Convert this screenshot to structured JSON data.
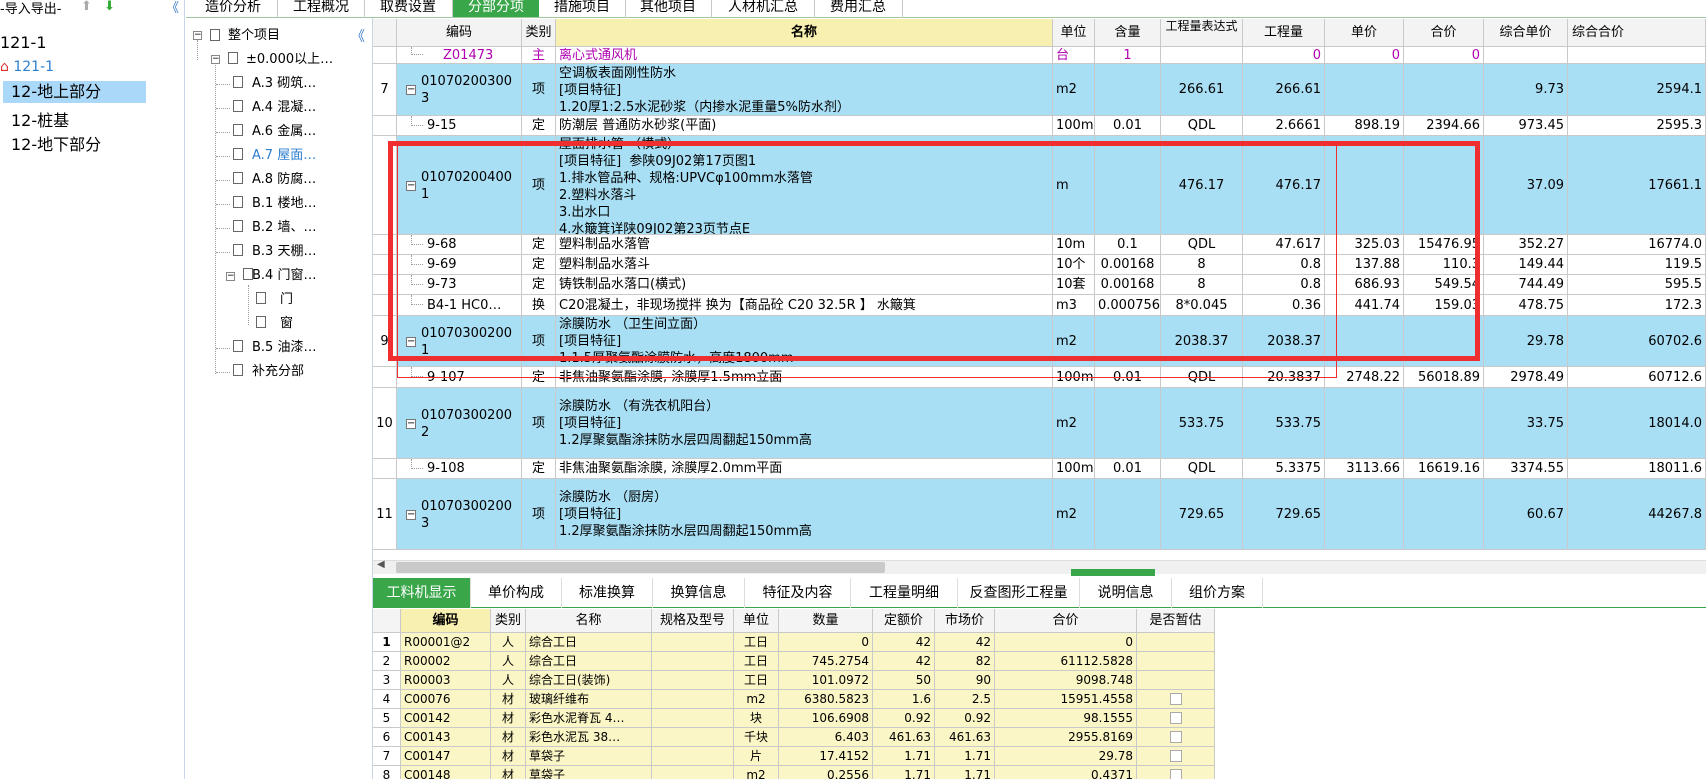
{
  "left_panel": {
    "header": "-导入导出-",
    "project": "121-1",
    "sub_project": "121-1",
    "items": [
      "12-地上部分",
      "12-桩基",
      "12-地下部分"
    ]
  },
  "tree": {
    "root": "整个项目",
    "items": [
      "±0.000以上…",
      "A.3 砌筑…",
      "A.4 混凝…",
      "A.6 金属…",
      "A.7 屋面…",
      "A.8 防腐…",
      "B.1 楼地…",
      "B.2 墙、…",
      "B.3 天棚…",
      "B.4 门窗…",
      "门",
      "窗",
      "B.5 油漆…",
      "补充分部"
    ]
  },
  "top_tabs": [
    "造价分析",
    "工程概况",
    "取费设置",
    "分部分项",
    "措施项目",
    "其他项目",
    "人材机汇总",
    "费用汇总"
  ],
  "grid": {
    "headers": [
      "编码",
      "类别",
      "名称",
      "单位",
      "含量",
      "工程量表达式",
      "工程量",
      "单价",
      "合价",
      "综合单价",
      "综合合价"
    ],
    "rows": [
      {
        "no": "",
        "code": "Z01473",
        "type": "主",
        "name": "离心式通风机",
        "unit": "台",
        "qty_rate": "1",
        "expr": "",
        "qty": "0",
        "price": "0",
        "total": "0",
        "unit_price": "",
        "sum": ""
      },
      {
        "no": "7",
        "code": "01070200300\n3",
        "type": "项",
        "name": "空调板表面刚性防水\n[项目特征]\n1.20厚1:2.5水泥砂浆（内掺水泥重量5%防水剂）",
        "unit": "m2",
        "qty_rate": "",
        "expr": "266.61",
        "qty": "266.61",
        "price": "",
        "total": "",
        "unit_price": "9.73",
        "sum": "2594.1"
      },
      {
        "no": "",
        "code": "9-15",
        "type": "定",
        "name": "防潮层 普通防水砂浆(平面)",
        "unit": "100m2",
        "qty_rate": "0.01",
        "expr": "QDL",
        "qty": "2.6661",
        "price": "898.19",
        "total": "2394.66",
        "unit_price": "973.45",
        "sum": "2595.3"
      },
      {
        "no": "",
        "code": "01070200400\n1",
        "type": "项",
        "name": "屋面排水管 （横式）\n[项目特征]  参陕09J02第17页图1\n1.排水管品种、规格:UPVCφ100mm水落管\n2.塑料水落斗\n3.出水口\n4.水簸箕详陕09J02第23页节点E",
        "unit": "m",
        "qty_rate": "",
        "expr": "476.17",
        "qty": "476.17",
        "price": "",
        "total": "",
        "unit_price": "37.09",
        "sum": "17661.1"
      },
      {
        "no": "",
        "code": "9-68",
        "type": "定",
        "name": "塑料制品水落管",
        "unit": "10m",
        "qty_rate": "0.1",
        "expr": "QDL",
        "qty": "47.617",
        "price": "325.03",
        "total": "15476.95",
        "unit_price": "352.27",
        "sum": "16774.0"
      },
      {
        "no": "",
        "code": "9-69",
        "type": "定",
        "name": "塑料制品水落斗",
        "unit": "10个",
        "qty_rate": "0.00168",
        "expr": "8",
        "qty": "0.8",
        "price": "137.88",
        "total": "110.3",
        "unit_price": "149.44",
        "sum": "119.5"
      },
      {
        "no": "",
        "code": "9-73",
        "type": "定",
        "name": "铸铁制品水落口(横式)",
        "unit": "10套",
        "qty_rate": "0.00168",
        "expr": "8",
        "qty": "0.8",
        "price": "686.93",
        "total": "549.54",
        "unit_price": "744.49",
        "sum": "595.5"
      },
      {
        "no": "",
        "code": "B4-1 HC0…",
        "type": "换",
        "name": "C20混凝土，非现场搅拌  换为【商品砼 C20 32.5R 】 水簸箕",
        "unit": "m3",
        "qty_rate": "0.000756",
        "expr": "8*0.045",
        "qty": "0.36",
        "price": "441.74",
        "total": "159.03",
        "unit_price": "478.75",
        "sum": "172.3"
      },
      {
        "no": "9",
        "code": "01070300200\n1",
        "type": "项",
        "name": "涂膜防水 （卫生间立面）\n[项目特征]\n1.1.5厚聚氨酯涂膜防水，高度1800mm",
        "unit": "m2",
        "qty_rate": "",
        "expr": "2038.37",
        "qty": "2038.37",
        "price": "",
        "total": "",
        "unit_price": "29.78",
        "sum": "60702.6"
      },
      {
        "no": "",
        "code": "9-107",
        "type": "定",
        "name": "非焦油聚氨酯涂膜, 涂膜厚1.5mm立面",
        "unit": "100m2",
        "qty_rate": "0.01",
        "expr": "QDL",
        "qty": "20.3837",
        "price": "2748.22",
        "total": "56018.89",
        "unit_price": "2978.49",
        "sum": "60712.6"
      },
      {
        "no": "10",
        "code": "01070300200\n2",
        "type": "项",
        "name": "涂膜防水 （有洗衣机阳台）\n[项目特征]\n1.2厚聚氨酯涂抹防水层四周翻起150mm高",
        "unit": "m2",
        "qty_rate": "",
        "expr": "533.75",
        "qty": "533.75",
        "price": "",
        "total": "",
        "unit_price": "33.75",
        "sum": "18014.0"
      },
      {
        "no": "",
        "code": "9-108",
        "type": "定",
        "name": "非焦油聚氨酯涂膜, 涂膜厚2.0mm平面",
        "unit": "100m2",
        "qty_rate": "0.01",
        "expr": "QDL",
        "qty": "5.3375",
        "price": "3113.66",
        "total": "16619.16",
        "unit_price": "3374.55",
        "sum": "18011.6"
      },
      {
        "no": "11",
        "code": "01070300200\n3",
        "type": "项",
        "name": "涂膜防水 （厨房）\n[项目特征]\n1.2厚聚氨酯涂抹防水层四周翻起150mm高",
        "unit": "m2",
        "qty_rate": "",
        "expr": "729.65",
        "qty": "729.65",
        "price": "",
        "total": "",
        "unit_price": "60.67",
        "sum": "44267.8"
      }
    ]
  },
  "bottom_tabs": [
    "工料机显示",
    "单价构成",
    "标准换算",
    "换算信息",
    "特征及内容",
    "工程量明细",
    "反查图形工程量",
    "说明信息",
    "组价方案"
  ],
  "bottom_grid": {
    "headers": [
      "编码",
      "类别",
      "名称",
      "规格及型号",
      "单位",
      "数量",
      "定额价",
      "市场价",
      "合价",
      "是否暂估"
    ],
    "rows": [
      {
        "no": "1",
        "code": "R00001@2",
        "type": "人",
        "name": "综合工日",
        "spec": "",
        "unit": "工日",
        "qty": "0",
        "quota": "42",
        "market": "42",
        "total": "0",
        "est": false
      },
      {
        "no": "2",
        "code": "R00002",
        "type": "人",
        "name": "综合工日",
        "spec": "",
        "unit": "工日",
        "qty": "745.2754",
        "quota": "42",
        "market": "82",
        "total": "61112.5828",
        "est": false
      },
      {
        "no": "3",
        "code": "R00003",
        "type": "人",
        "name": "综合工日(装饰)",
        "spec": "",
        "unit": "工日",
        "qty": "101.0972",
        "quota": "50",
        "market": "90",
        "total": "9098.748",
        "est": false
      },
      {
        "no": "4",
        "code": "C00076",
        "type": "材",
        "name": "玻璃纤维布",
        "spec": "",
        "unit": "m2",
        "qty": "6380.5823",
        "quota": "1.6",
        "market": "2.5",
        "total": "15951.4558",
        "est": true
      },
      {
        "no": "5",
        "code": "C00142",
        "type": "材",
        "name": "彩色水泥脊瓦 4…",
        "spec": "",
        "unit": "块",
        "qty": "106.6908",
        "quota": "0.92",
        "market": "0.92",
        "total": "98.1555",
        "est": true
      },
      {
        "no": "6",
        "code": "C00143",
        "type": "材",
        "name": "彩色水泥瓦 38…",
        "spec": "",
        "unit": "千块",
        "qty": "6.403",
        "quota": "461.63",
        "market": "461.63",
        "total": "2955.8169",
        "est": true
      },
      {
        "no": "7",
        "code": "C00147",
        "type": "材",
        "name": "草袋子",
        "spec": "",
        "unit": "片",
        "qty": "17.4152",
        "quota": "1.71",
        "market": "1.71",
        "total": "29.78",
        "est": true
      },
      {
        "no": "8",
        "code": "C00148",
        "type": "材",
        "name": "草袋子",
        "spec": "",
        "unit": "m2",
        "qty": "0.2556",
        "quota": "1.71",
        "market": "1.71",
        "total": "0.4371",
        "est": true
      }
    ]
  },
  "colors": {
    "accent": "#3aa64a",
    "row_highlight": "#a9dff4",
    "annotation": "#ef2f2f",
    "material_cell": "#fbf6c5"
  }
}
